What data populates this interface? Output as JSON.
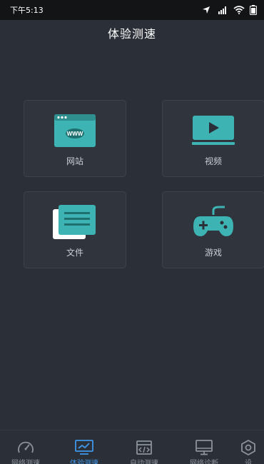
{
  "status_bar": {
    "time": "下午5:13"
  },
  "header": {
    "title": "体验测速"
  },
  "tiles": [
    {
      "label": "网站",
      "icon": "website-icon"
    },
    {
      "label": "视频",
      "icon": "video-icon"
    },
    {
      "label": "文件",
      "icon": "file-icon"
    },
    {
      "label": "游戏",
      "icon": "game-controller-icon"
    }
  ],
  "tabs": [
    {
      "label": "网络测速",
      "icon": "speedometer-icon",
      "active": false
    },
    {
      "label": "体验测速",
      "icon": "monitor-chart-icon",
      "active": true
    },
    {
      "label": "自动测速",
      "icon": "code-window-icon",
      "active": false
    },
    {
      "label": "网络诊断",
      "icon": "desktop-icon",
      "active": false
    },
    {
      "label": "设",
      "icon": "settings-icon",
      "active": false
    }
  ],
  "colors": {
    "accent": "#3f96e8",
    "icon_teal": "#3db3b3",
    "background": "#2b3038",
    "tile": "#30353d"
  }
}
